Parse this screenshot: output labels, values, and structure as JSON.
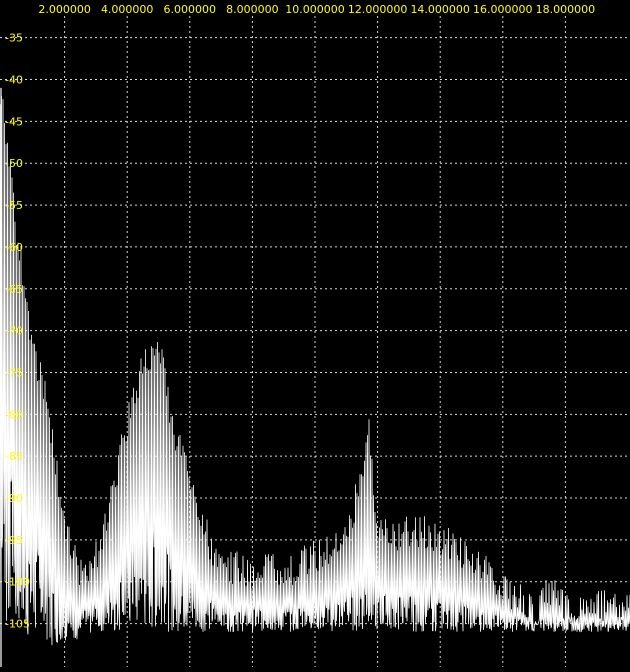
{
  "chart_data": {
    "type": "line",
    "title": "",
    "xlabel": "",
    "ylabel": "",
    "x_ticks": [
      "2.000000",
      "4.000000",
      "6.000000",
      "8.000000",
      "10.000000",
      "12.000000",
      "14.000000",
      "16.000000",
      "18.000000"
    ],
    "x_tick_values": [
      2,
      4,
      6,
      8,
      10,
      12,
      14,
      16,
      18
    ],
    "y_ticks": [
      "-35",
      "-40",
      "-45",
      "-50",
      "-55",
      "-60",
      "-65",
      "-70",
      "-75",
      "-80",
      "-85",
      "-90",
      "-95",
      "-100",
      "-105"
    ],
    "y_tick_values": [
      -35,
      -40,
      -45,
      -50,
      -55,
      -60,
      -65,
      -70,
      -75,
      -80,
      -85,
      -90,
      -95,
      -100,
      -105
    ],
    "xlim": [
      0,
      20
    ],
    "ylim": [
      -109.5,
      -30.5
    ],
    "grid": true,
    "series": [
      {
        "values_x": [
          0.0,
          0.5,
          1.0,
          1.5,
          2.0,
          2.5,
          3.0,
          3.5,
          4.0,
          4.5,
          5.0,
          5.5,
          6.0,
          6.5,
          7.0,
          7.5,
          8.0,
          8.5,
          9.0,
          9.5,
          10.0,
          10.5,
          11.0,
          11.5,
          11.75,
          12.0,
          12.5,
          13.0,
          13.5,
          14.0,
          14.5,
          15.0,
          15.5,
          16.0,
          16.5,
          17.0,
          17.5,
          18.0,
          18.5,
          19.0,
          19.5,
          20.0
        ],
        "peak_values": [
          -41,
          -57,
          -70,
          -78,
          -92,
          -97,
          -95,
          -88,
          -79,
          -72,
          -70,
          -80,
          -86,
          -92,
          -97,
          -96,
          -97,
          -96,
          -97,
          -96,
          -95,
          -94,
          -93,
          -85,
          -80,
          -92,
          -93,
          -92,
          -92,
          -93,
          -94,
          -95,
          -97,
          -99,
          -100,
          -102,
          -99,
          -101,
          -101,
          -101,
          -101,
          -101
        ],
        "floor_values": [
          -106,
          -107,
          -107,
          -108,
          -107,
          -107,
          -106,
          -106,
          -106,
          -106,
          -106,
          -106,
          -106,
          -106,
          -106,
          -106,
          -106,
          -106,
          -106,
          -106,
          -106,
          -106,
          -106,
          -106,
          -106,
          -106,
          -106,
          -106,
          -106,
          -106,
          -106,
          -106,
          -106,
          -106,
          -106,
          -106,
          -106,
          -106,
          -106,
          -106,
          -106,
          -106
        ],
        "color": "#ffffff"
      }
    ],
    "colors": {
      "background": "#000000",
      "trace": "#ffffff",
      "grid": "#d8d8d8",
      "tick_label": "#ffff00"
    }
  }
}
